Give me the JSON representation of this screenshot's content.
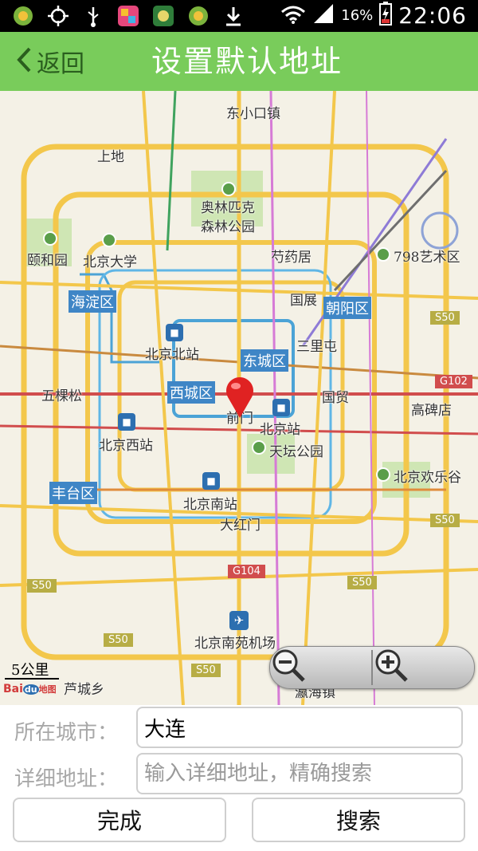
{
  "status_bar": {
    "battery_percent": "16%",
    "time": "22:06",
    "icons": [
      "app-icon",
      "gps-icon",
      "usb-icon",
      "app-store-icon",
      "app-icon",
      "app-icon",
      "download-icon",
      "wifi-icon",
      "signal-icon",
      "battery-icon"
    ]
  },
  "title_bar": {
    "back_label": "返回",
    "title": "设置默认地址",
    "background": "#79cc5b"
  },
  "map": {
    "places": [
      "东小口镇",
      "上地",
      "奥林匹克",
      "森林公园",
      "颐和园",
      "北京大学",
      "芍药居",
      "798艺术区",
      "国展",
      "北京北站",
      "三里屯",
      "五棵松",
      "前门",
      "国贸",
      "高碑店",
      "北京站",
      "天坛公园",
      "北京西站",
      "北京欢乐谷",
      "北京南站",
      "大红门",
      "北京南苑机场",
      "芦城乡",
      "瀛海镇"
    ],
    "districts": [
      "海淀区",
      "朝阳区",
      "东城区",
      "西城区",
      "丰台区"
    ],
    "road_shields": [
      "S50",
      "G102",
      "S50",
      "G104",
      "S50",
      "S50",
      "S50",
      "S50"
    ],
    "scale": "5公里",
    "logo": {
      "bai": "Bai",
      "du": "du",
      "tu": "地图"
    }
  },
  "form": {
    "city_label": "所在城市：",
    "city_value": "大连",
    "address_label": "详细地址：",
    "address_placeholder": "输入详细地址，精确搜索",
    "done_button": "完成",
    "search_button": "搜索"
  }
}
